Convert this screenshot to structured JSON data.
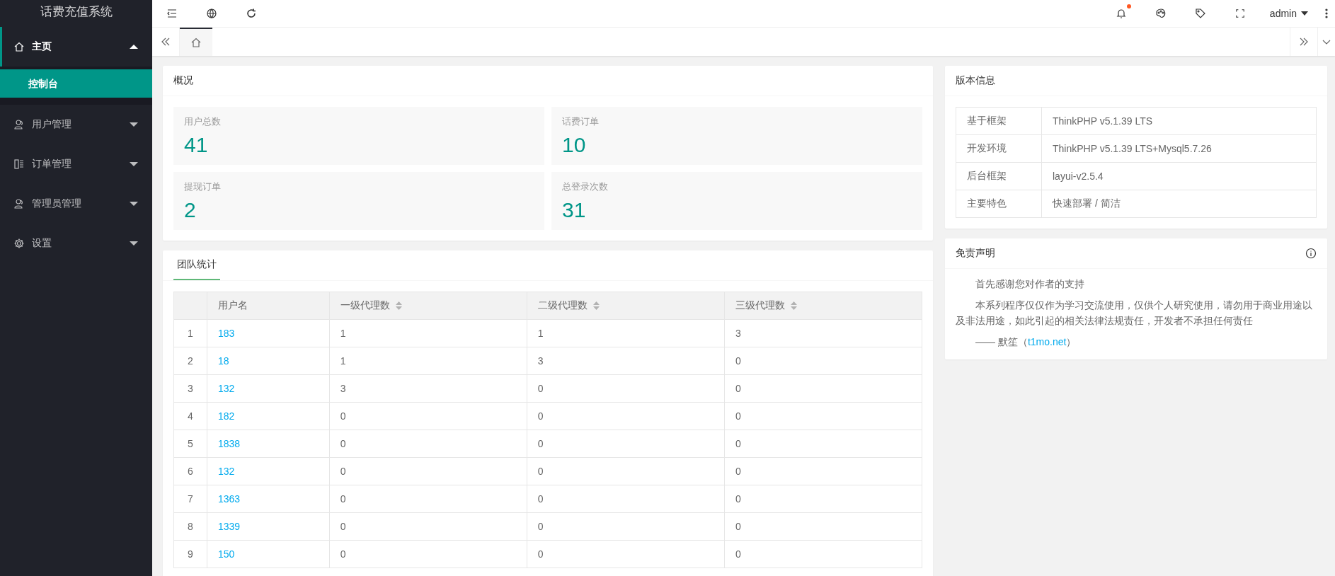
{
  "app": {
    "title": "话费充值系统"
  },
  "sidebar": {
    "items": [
      {
        "label": "主页",
        "expanded": true,
        "children": [
          {
            "label": "控制台",
            "selected": true
          }
        ]
      },
      {
        "label": "用户管理",
        "expanded": false
      },
      {
        "label": "订单管理",
        "expanded": false
      },
      {
        "label": "管理员管理",
        "expanded": false
      },
      {
        "label": "设置",
        "expanded": false
      }
    ]
  },
  "header": {
    "unread": true,
    "user": "admin"
  },
  "tabs": [
    {
      "selected": true
    }
  ],
  "overview": {
    "title": "概况",
    "stats": [
      {
        "label": "用户总数",
        "value": "41"
      },
      {
        "label": "话费订单",
        "value": "10"
      },
      {
        "label": "提现订单",
        "value": "2"
      },
      {
        "label": "总登录次数",
        "value": "31"
      }
    ]
  },
  "team": {
    "tab": "团队统计",
    "columns": [
      {
        "label": "用户名",
        "sortable": false
      },
      {
        "label": "一级代理数",
        "sortable": true
      },
      {
        "label": "二级代理数",
        "sortable": true
      },
      {
        "label": "三级代理数",
        "sortable": true
      }
    ],
    "rows": [
      {
        "index": "1",
        "cells": [
          "183",
          "1",
          "1",
          "3"
        ]
      },
      {
        "index": "2",
        "cells": [
          "18",
          "1",
          "3",
          "0"
        ]
      },
      {
        "index": "3",
        "cells": [
          "132",
          "3",
          "0",
          "0"
        ]
      },
      {
        "index": "4",
        "cells": [
          "182",
          "0",
          "0",
          "0"
        ]
      },
      {
        "index": "5",
        "cells": [
          "1838",
          "0",
          "0",
          "0"
        ]
      },
      {
        "index": "6",
        "cells": [
          "132",
          "0",
          "0",
          "0"
        ]
      },
      {
        "index": "7",
        "cells": [
          "1363",
          "0",
          "0",
          "0"
        ]
      },
      {
        "index": "8",
        "cells": [
          "1339",
          "0",
          "0",
          "0"
        ]
      },
      {
        "index": "9",
        "cells": [
          "150",
          "0",
          "0",
          "0"
        ]
      }
    ]
  },
  "version": {
    "title": "版本信息",
    "rows": [
      {
        "label": "基于框架",
        "value": "ThinkPHP v5.1.39 LTS"
      },
      {
        "label": "开发环境",
        "value": "ThinkPHP v5.1.39 LTS+Mysql5.7.26"
      },
      {
        "label": "后台框架",
        "value": "layui-v2.5.4"
      },
      {
        "label": "主要特色",
        "value": "快速部署 / 简洁"
      }
    ]
  },
  "disclaimer": {
    "title": "免责声明",
    "paragraphs": [
      "首先感谢您对作者的支持",
      "本系列程序仅仅作为学习交流使用，仅供个人研究使用，请勿用于商业用途以及非法用途，如此引起的相关法律法规责任，开发者不承担任何责任"
    ],
    "signature": "—— 默笙（",
    "link": "t1mo.net",
    "signature_end": "）"
  }
}
